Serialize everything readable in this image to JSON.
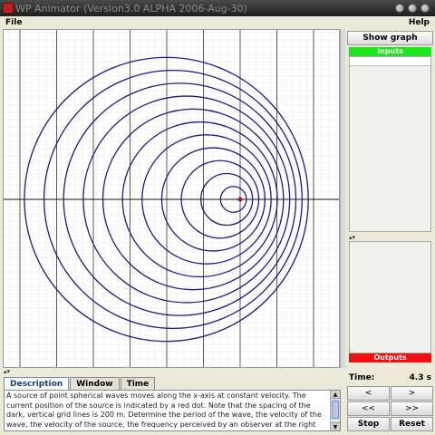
{
  "window": {
    "title": "WP Animator (Version3.0 ALPHA 2006-Aug-30)"
  },
  "menu": {
    "file": "File",
    "help": "Help"
  },
  "colors": {
    "wave": "#1a1a8c",
    "source": "#ff0000",
    "inputs_bar": "#1ce61c",
    "outputs_bar": "#ee1111"
  },
  "graph": {
    "wave_centers_x": [
      0,
      8,
      16,
      24,
      32,
      40,
      48,
      56,
      64,
      72,
      80,
      88
    ],
    "wave_radii": [
      1,
      8,
      16,
      24,
      32,
      40,
      48,
      56,
      64,
      72,
      80,
      88
    ]
  },
  "tabs": [
    "Description",
    "Window",
    "Time"
  ],
  "description": "A source of point spherical waves moves along the x-axis at constant velocity. The current position of the source is indicated by a red dot. Note that the spacing of the dark, vertical grid lines is 200 m. Determine the period of the wave, the velocity of the wave, the velocity of the source, the frequency perceived by an observer at the right edge",
  "right_panel": {
    "show_graph": "Show graph",
    "inputs": "Inputs",
    "outputs": "Outputs",
    "time_label": "Time:",
    "time_value": "4.3 s",
    "step_back": "<",
    "step_forward": ">",
    "fast_back": "<<",
    "fast_forward": ">>",
    "stop": "Stop",
    "reset": "Reset"
  },
  "icons": {
    "divider_arrows": "▴▾",
    "scroll_up": "▲",
    "scroll_down": "▼"
  }
}
